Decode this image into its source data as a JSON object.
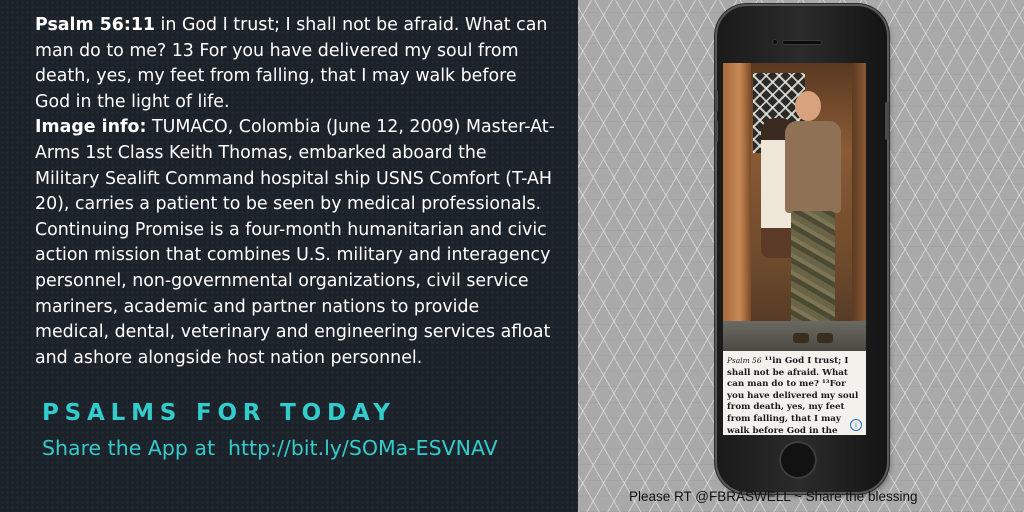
{
  "left_panel": {
    "verse_ref": "Psalm 56:11",
    "verse_text": " in God I trust; I shall not be afraid. What can man do to me? 13 For you have delivered my soul from death, yes, my feet from falling, that I may walk before God in the light of life.",
    "image_info_label": "Image info:",
    "image_info_text": " TUMACO, Colombia (June 12, 2009) Master-At-Arms 1st Class Keith Thomas, embarked aboard the Military Sealift Command hospital ship USNS Comfort (T-AH 20), carries a patient to be seen by medical professionals. Continuing Promise is a four-month humanitarian and civic action mission that combines U.S. military and interagency personnel, non-governmental organizations, civil service mariners, academic and partner nations to provide medical, dental, veterinary and engineering services afloat and ashore alongside host nation personnel.",
    "title": "PSALMS FOR TODAY",
    "share_line": "Share the App at  http://bit.ly/SOMa-ESVNAV"
  },
  "phone": {
    "verse_card": {
      "ref": "Psalm 56",
      "text": " ¹¹in God I trust; I shall not be afraid. What can man do to me? ¹³For you have delivered my soul from death, yes, my feet from falling, that I may walk before God in the light of life."
    },
    "info_icon": "i"
  },
  "footer": "Please RT @FBRASWELL ~ Share the blessing",
  "colors": {
    "left_bg": "#1c222a",
    "accent": "#33cccc",
    "right_bg": "#a9a9a9"
  }
}
